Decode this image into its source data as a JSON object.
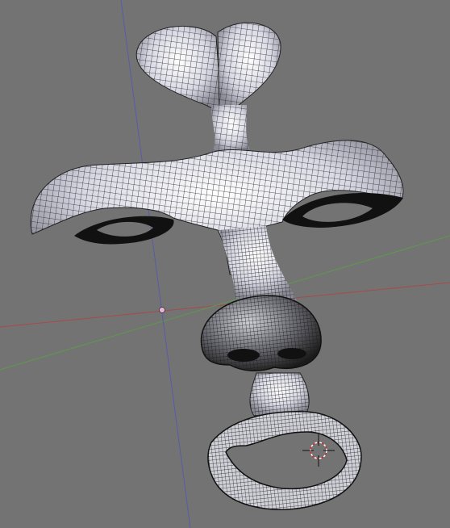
{
  "viewport": {
    "background": "#737373",
    "axis_colors": {
      "x_axis": "#a84a4a",
      "y_axis": "#5e9a4a",
      "z_axis": "#5a5aa8"
    },
    "mesh_color": "#e6e6f0",
    "wire_color": "#1a1a1a"
  },
  "objects": [
    {
      "name": "face-mesh",
      "type": "wireframe-mesh"
    },
    {
      "name": "object-origin",
      "type": "origin-dot"
    },
    {
      "name": "3d-cursor",
      "type": "3d-cursor"
    }
  ]
}
